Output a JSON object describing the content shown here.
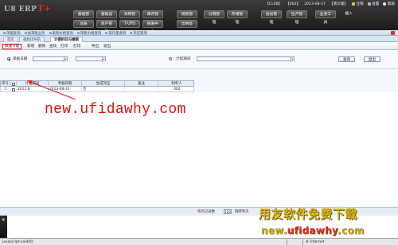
{
  "app": {
    "logo_text": "U8 ERP",
    "logo_suffix": "T+"
  },
  "header": {
    "status_items": [
      "【CL08】",
      "【002】",
      "2013-08-17",
      "【演示版】"
    ],
    "right_links": [
      "注销",
      "设置",
      "帮助"
    ],
    "menu_row1": [
      "基础管理",
      "基础设置",
      "采购管理",
      "库存管理",
      "销售管理",
      "分销管理",
      "存储管理",
      "会员管理",
      "生产管理",
      "业务工具"
    ],
    "menu_row2": [
      "总账",
      "资产管理",
      "T-UFO",
      "报表中心",
      "出纳处"
    ],
    "extra_link": "插入"
  },
  "toolbar_band": {
    "items": [
      "单据查询",
      "往来账业务",
      "采购价格查询",
      "销售价格查询",
      "现存量查询",
      "凭证管理"
    ]
  },
  "doc_tabs": [
    "首页",
    "初始化导航",
    "计提折旧与摊销"
  ],
  "func_bar": {
    "buttons": [
      "快速计提",
      "新增",
      "删除",
      "查找",
      "打印",
      "打印",
      "导出",
      "退出"
    ]
  },
  "query": {
    "option1_label": "单据日期",
    "option2_label": "计提期间",
    "date_from": "",
    "date_to": "",
    "period_value": "",
    "search_button": "查询",
    "exit_button": "退出"
  },
  "grid": {
    "columns": [
      "序号",
      "",
      "计提期间",
      "单据日期",
      "生成凭证",
      "备注",
      "制单人"
    ],
    "rows": [
      {
        "seq": "1",
        "period": "2013.8",
        "date": "2013-08-31",
        "voucher": "否",
        "remark": "",
        "creator": "002"
      }
    ]
  },
  "watermark": {
    "url": "new.ufidawhy.com",
    "title": "用友软件免费下载",
    "url2_prefix": "new.",
    "url2_middle": "ufidawhy",
    "url2_suffix": ".com"
  },
  "pager": {
    "records_label": "每页记录数",
    "records_value": "100",
    "goto_label": "跳转到页"
  },
  "statusbar": {
    "left_text": "javascript:void(0)",
    "zone_text": "Internet"
  },
  "colors": {
    "accent_red": "#e41e1e",
    "header_dark": "#1c1c1c",
    "watermark_gold": "#d8b413"
  }
}
